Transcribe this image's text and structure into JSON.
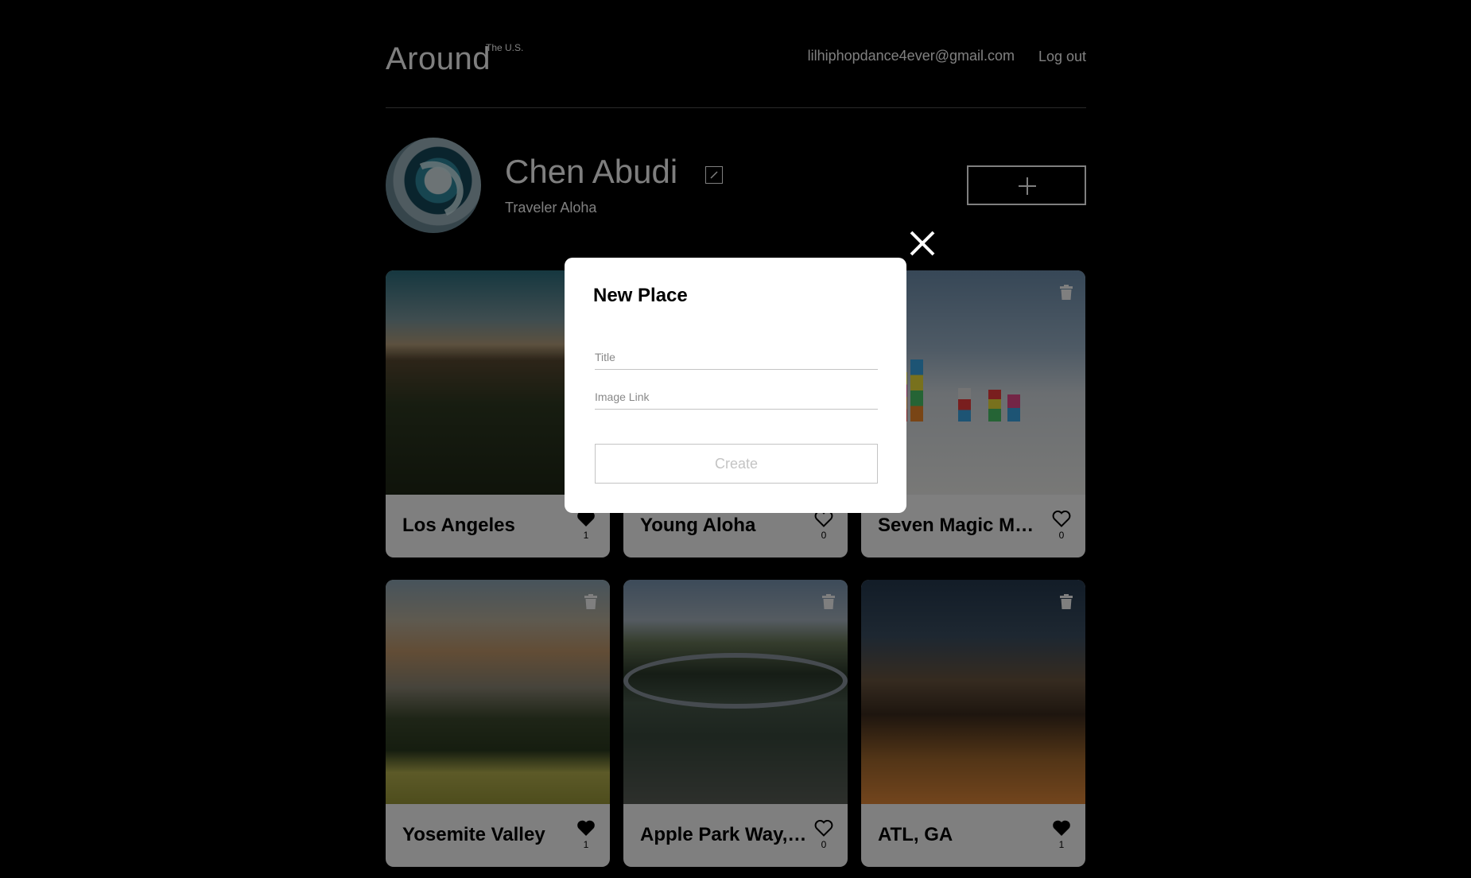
{
  "header": {
    "logo": "Around",
    "logo_sup": "The U.S.",
    "email": "lilhiphopdance4ever@gmail.com",
    "logout": "Log out"
  },
  "profile": {
    "name": "Chen Abudi",
    "about": "Traveler Aloha"
  },
  "cards": [
    {
      "title": "Los Angeles",
      "likes": "1",
      "liked": true
    },
    {
      "title": "Young Aloha",
      "likes": "0",
      "liked": false
    },
    {
      "title": "Seven Magic Mountains",
      "likes": "0",
      "liked": false
    },
    {
      "title": "Yosemite Valley",
      "likes": "1",
      "liked": true
    },
    {
      "title": "Apple Park Way, Cupertino",
      "likes": "0",
      "liked": false
    },
    {
      "title": "ATL, GA",
      "likes": "1",
      "liked": true
    }
  ],
  "modal": {
    "title": "New Place",
    "title_placeholder": "Title",
    "link_placeholder": "Image Link",
    "create_label": "Create"
  },
  "icons": {
    "edit": "pencil-icon",
    "add": "plus-icon",
    "like": "heart-icon",
    "delete": "trash-icon",
    "close": "close-icon"
  },
  "colors": {
    "background": "#000000",
    "card": "#ffffff",
    "disabled": "#c4c4c4"
  }
}
